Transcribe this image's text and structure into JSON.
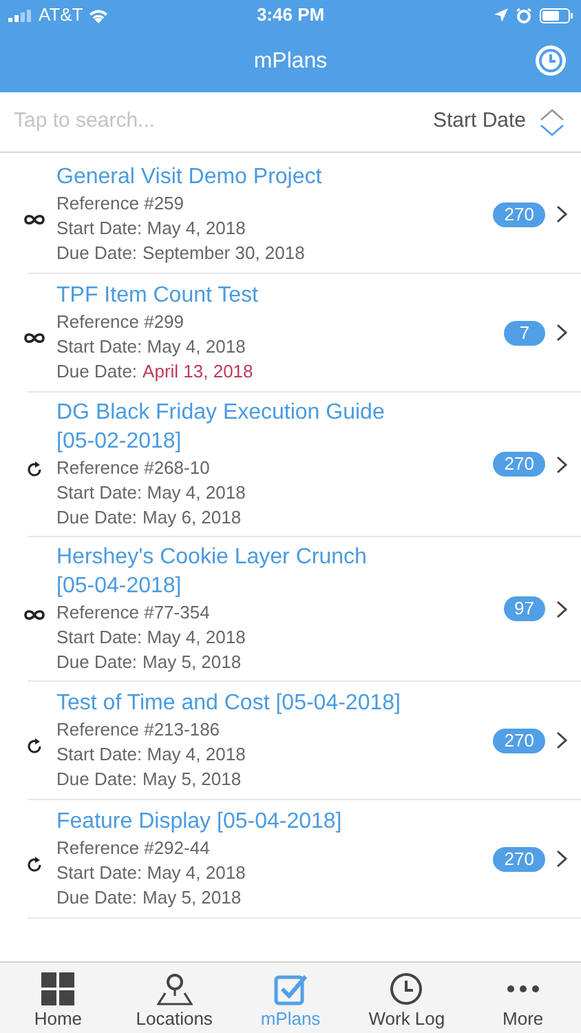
{
  "status_bar": {
    "carrier": "AT&T",
    "time": "3:46 PM"
  },
  "header": {
    "title": "mPlans"
  },
  "search": {
    "placeholder": "Tap to search..."
  },
  "sort": {
    "label": "Start Date",
    "descending": true
  },
  "plans": [
    {
      "kind": "infinite",
      "title": "General Visit Demo Project",
      "reference": "Reference #259",
      "start": "Start Date: May 4, 2018",
      "due_label": "Due Date:",
      "due": "September 30, 2018",
      "overdue": false,
      "count": "270"
    },
    {
      "kind": "infinite",
      "title": "TPF Item Count Test",
      "reference": "Reference #299",
      "start": "Start Date: May 4, 2018",
      "due_label": "Due Date:",
      "due": "April 13, 2018",
      "overdue": true,
      "count": "7"
    },
    {
      "kind": "recurring",
      "title": "DG Black Friday Execution Guide [05-02-2018]",
      "reference": "Reference #268-10",
      "start": "Start Date: May 4, 2018",
      "due_label": "Due Date:",
      "due": "May 6, 2018",
      "overdue": false,
      "count": "270"
    },
    {
      "kind": "infinite",
      "title": "Hershey's Cookie Layer Crunch [05-04-2018]",
      "reference": "Reference #77-354",
      "start": "Start Date: May 4, 2018",
      "due_label": "Due Date:",
      "due": "May 5, 2018",
      "overdue": false,
      "count": "97"
    },
    {
      "kind": "recurring",
      "title": "Test of Time and Cost [05-04-2018]",
      "reference": "Reference #213-186",
      "start": "Start Date: May 4, 2018",
      "due_label": "Due Date:",
      "due": "May 5, 2018",
      "overdue": false,
      "count": "270"
    },
    {
      "kind": "recurring",
      "title": "Feature Display [05-04-2018]",
      "reference": "Reference #292-44",
      "start": "Start Date: May 4, 2018",
      "due_label": "Due Date:",
      "due": "May 5, 2018",
      "overdue": false,
      "count": "270"
    }
  ],
  "tabs": [
    {
      "kind": "home",
      "label": "Home",
      "selected": false
    },
    {
      "kind": "locations",
      "label": "Locations",
      "selected": false
    },
    {
      "kind": "plans",
      "label": "mPlans",
      "selected": true
    },
    {
      "kind": "worklog",
      "label": "Work Log",
      "selected": false
    },
    {
      "kind": "more",
      "label": "More",
      "selected": false
    }
  ]
}
